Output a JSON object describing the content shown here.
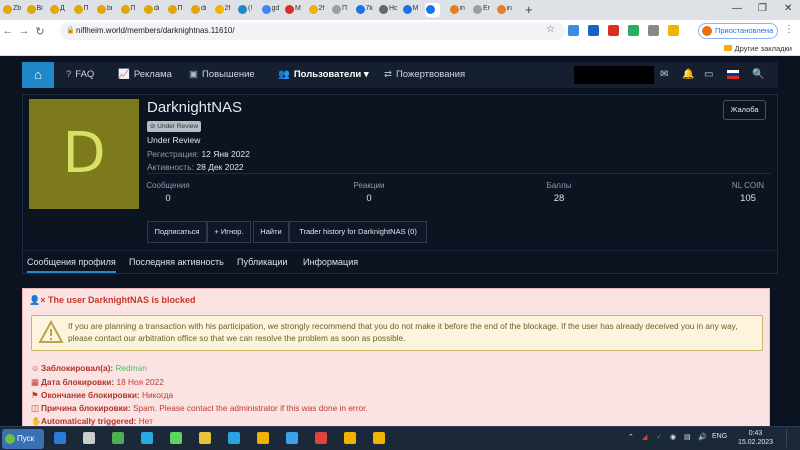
{
  "browser": {
    "tabs": [
      "Zb",
      "Bi",
      "Д",
      "П",
      "bi",
      "П",
      "di",
      "П",
      "di",
      "2f",
      "(!",
      "gd",
      "M",
      "2f",
      "П",
      "7k",
      "Нова",
      "M",
      "",
      "in",
      "Er",
      "in"
    ],
    "tab_colors": [
      "#e0a800",
      "#e0a800",
      "#e0a800",
      "#e0a800",
      "#e0a800",
      "#e0a800",
      "#e0a800",
      "#e0a800",
      "#e0a800",
      "#f0b400",
      "#1e88c8",
      "#4285f4",
      "#d93025",
      "#f0b400",
      "#9e9e9e",
      "#1a73e8",
      "#666666",
      "#1a73e8",
      "#1a73e8",
      "#e67e22",
      "#9e9e9e",
      "#e67e22"
    ],
    "new_tab": "+",
    "controls": {
      "minimize": "—",
      "maximize": "❐",
      "close": "✕"
    },
    "url": "niflheim.world/members/darknightnas.11610/",
    "profile_status": "Приостановлена",
    "bookmarks_folder": "Другие закладки"
  },
  "nav": {
    "home_icon": "home-icon",
    "items": [
      {
        "label": "FAQ",
        "icon": "?"
      },
      {
        "label": "Реклама",
        "icon": "📈"
      },
      {
        "label": "Повышение",
        "icon": "▣"
      },
      {
        "label": "Пользователи",
        "icon": "👥",
        "dropdown": "▾"
      },
      {
        "label": "Пожертвования",
        "icon": "⇄"
      }
    ],
    "icons": [
      "✉",
      "🔔",
      "▭",
      "🔍"
    ],
    "flag_colors": [
      "#ffffff",
      "#0039a6",
      "#d52b1e"
    ]
  },
  "profile": {
    "avatar_letter": "D",
    "name": "DarknightNAS",
    "badge": "⊘ Under Review",
    "user_title": "Under Review",
    "registered_label": "Регистрация:",
    "registered_value": "12 Янв 2022",
    "activity_label": "Активность:",
    "activity_value": "28 Дек 2022",
    "report_button": "Жалоба",
    "stats": [
      {
        "label": "Сообщения",
        "value": "0"
      },
      {
        "label": "Реакции",
        "value": "0"
      },
      {
        "label": "Баллы",
        "value": "28"
      },
      {
        "label": "NL COIN",
        "value": "105"
      }
    ],
    "actions": [
      "Подписаться",
      "+ Игнор.",
      "Найти",
      "Trader history for DarknightNAS (0)"
    ],
    "tabs": [
      "Сообщения профиля",
      "Последняя активность",
      "Публикации",
      "Информация"
    ]
  },
  "block": {
    "title": "The user DarknightNAS is blocked",
    "warning": "If you are planning a transaction with his participation, we strongly recommend that you do not make it before the end of the blockage. If the user has already deceived you in any way, please contact our arbitration office so that we can resolve the problem as soon as possible.",
    "rows": [
      {
        "label": "Заблокировал(а):",
        "value": "Redman",
        "icon": "☺"
      },
      {
        "label": "Дата блокировки:",
        "value": "18 Ноя 2022",
        "icon": "▦"
      },
      {
        "label": "Окончание блокировки:",
        "value": "Никогда",
        "icon": "⚑"
      },
      {
        "label": "Причина блокировки:",
        "value": "Spam. Please contact the administrator if this was done in error.",
        "icon": "◫"
      },
      {
        "label": "Automatically triggered:",
        "value": "Нет",
        "icon": "✋"
      }
    ]
  },
  "taskbar": {
    "start": "Пуск",
    "app_colors": [
      "#2b7bd6",
      "#cccccc",
      "#4caf50",
      "#29a9e0",
      "#5cd65c",
      "#e8c33a",
      "#2aa3e0",
      "#f0b400",
      "#3da2e8",
      "#e0433b",
      "#f0b400",
      "#f0b400"
    ],
    "lang": "ENG",
    "time": "0:43",
    "date": "15.02.2023"
  }
}
